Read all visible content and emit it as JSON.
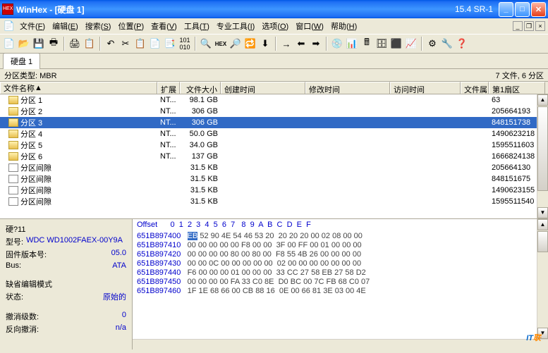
{
  "title": "WinHex - [硬盘 1]",
  "version": "15.4 SR-1",
  "menu": {
    "file": "文件",
    "edit": "编辑",
    "search": "搜索",
    "pos": "位置",
    "view": "查看",
    "tool": "工具",
    "pro": "专业工具",
    "opts": "选项",
    "win": "窗口",
    "help": "帮助",
    "file_u": "F",
    "edit_u": "E",
    "search_u": "S",
    "pos_u": "P",
    "view_u": "V",
    "tool_u": "T",
    "pro_u": "I",
    "opts_u": "O",
    "win_u": "W",
    "help_u": "H"
  },
  "tab1": "硬盘 1",
  "status_left": "分区类型: MBR",
  "status_right": "7 文件, 6 分区",
  "cols": {
    "name": "文件名称",
    "ext": "扩展",
    "size": "文件大小",
    "create": "创建时间",
    "mod": "修改时间",
    "acc": "访问时间",
    "attr": "文件属",
    "sect": "第1扇区"
  },
  "rows": [
    {
      "icon": "p",
      "name": "分区 1",
      "ext": "NT...",
      "size": "98.1 GB",
      "sect": "63"
    },
    {
      "icon": "p",
      "name": "分区 2",
      "ext": "NT...",
      "size": "306 GB",
      "sect": "205664193"
    },
    {
      "icon": "p",
      "name": "分区 3",
      "ext": "NT...",
      "size": "306 GB",
      "sect": "848151738",
      "sel": true
    },
    {
      "icon": "p",
      "name": "分区 4",
      "ext": "NT...",
      "size": "50.0 GB",
      "sect": "1490623218"
    },
    {
      "icon": "p",
      "name": "分区 5",
      "ext": "NT...",
      "size": "34.0 GB",
      "sect": "1595511603"
    },
    {
      "icon": "p",
      "name": "分区 6",
      "ext": "NT...",
      "size": "137 GB",
      "sect": "1666824138"
    },
    {
      "icon": "g",
      "name": "分区间隙",
      "ext": "",
      "size": "31.5 KB",
      "sect": "205664130"
    },
    {
      "icon": "g",
      "name": "分区间隙",
      "ext": "",
      "size": "31.5 KB",
      "sect": "848151675"
    },
    {
      "icon": "g",
      "name": "分区间隙",
      "ext": "",
      "size": "31.5 KB",
      "sect": "1490623155"
    },
    {
      "icon": "g",
      "name": "分区间隙",
      "ext": "",
      "size": "31.5 KB",
      "sect": "1595511540"
    }
  ],
  "info": {
    "disk_lbl": "硬?11",
    "model_lbl": "型号:",
    "model": "WDC WD1002FAEX-00Y9A",
    "fw_lbl": "固件版本号:",
    "fw": "05.0",
    "bus_lbl": "Bus:",
    "bus": "ATA",
    "mode_lbl": "缺省编辑模式",
    "state_lbl": "状态:",
    "state": "原始的",
    "undo_lbl": "撤消级数:",
    "undo": "0",
    "rev_lbl": "反向撤消:",
    "rev": "n/a"
  },
  "hex": {
    "header": "Offset      0  1  2  3  4  5  6  7   8  9  A  B  C  D  E  F",
    "lines": [
      {
        "off": "651B897400",
        "b": "EB 52 90 4E 54 46 53 20  20 20 20 00 02 08 00 00"
      },
      {
        "off": "651B897410",
        "b": "00 00 00 00 00 F8 00 00  3F 00 FF 00 01 00 00 00"
      },
      {
        "off": "651B897420",
        "b": "00 00 00 00 80 00 80 00  F8 55 4B 26 00 00 00 00"
      },
      {
        "off": "651B897430",
        "b": "00 00 0C 00 00 00 00 00  02 00 00 00 00 00 00 00"
      },
      {
        "off": "651B897440",
        "b": "F6 00 00 00 01 00 00 00  33 CC 27 58 EB 27 58 D2"
      },
      {
        "off": "651B897450",
        "b": "00 00 00 00 FA 33 C0 8E  D0 BC 00 7C FB 68 C0 07"
      },
      {
        "off": "651B897460",
        "b": "1F 1E 68 66 00 CB 88 16  0E 00 66 81 3E 03 00 4E"
      }
    ]
  },
  "chart_data": null
}
